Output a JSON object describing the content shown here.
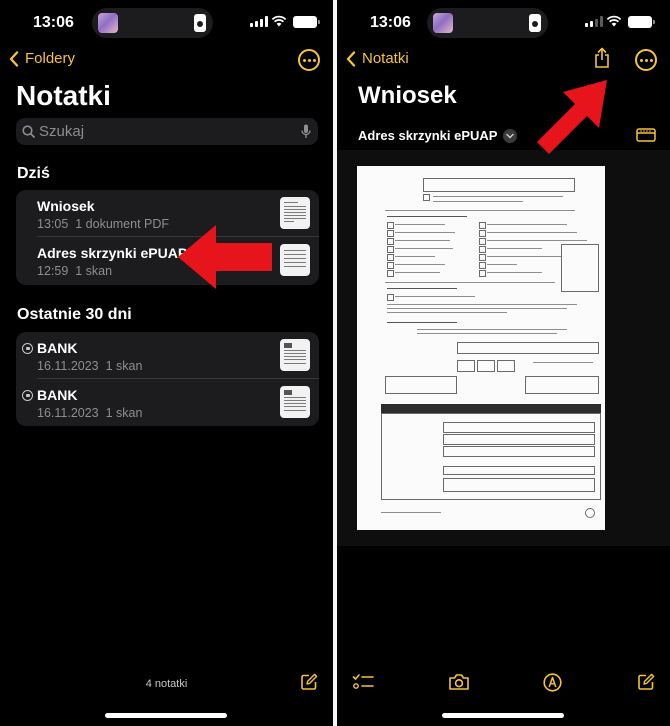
{
  "left": {
    "status": {
      "time": "13:06"
    },
    "nav": {
      "back_label": "Foldery"
    },
    "title": "Notatki",
    "search": {
      "placeholder": "Szukaj"
    },
    "sections": [
      {
        "header": "Dziś",
        "items": [
          {
            "title": "Wniosek",
            "time": "13:05",
            "detail": "1 dokument PDF",
            "locked": false
          },
          {
            "title": "Adres skrzynki ePUAP",
            "time": "12:59",
            "detail": "1 skan",
            "locked": false
          }
        ]
      },
      {
        "header": "Ostatnie 30 dni",
        "items": [
          {
            "title": "BANK",
            "time": "16.11.2023",
            "detail": "1 skan",
            "locked": true
          },
          {
            "title": "BANK",
            "time": "16.11.2023",
            "detail": "1 skan",
            "locked": true
          }
        ]
      }
    ],
    "footer": {
      "count": "4 notatki"
    }
  },
  "right": {
    "status": {
      "time": "13:06"
    },
    "nav": {
      "back_label": "Notatki"
    },
    "title": "Wniosek",
    "attachment": {
      "title": "Adres skrzynki ePUAP"
    }
  },
  "colors": {
    "accent": "#f6c33a",
    "annotation_arrow": "#e8141b",
    "background": "#000000",
    "card": "#1c1c1e"
  },
  "icons": [
    "chevron-left-icon",
    "more-icon",
    "search-icon",
    "microphone-icon",
    "share-icon",
    "scan-view-icon",
    "checklist-icon",
    "camera-icon",
    "markup-pen-icon",
    "compose-icon"
  ]
}
